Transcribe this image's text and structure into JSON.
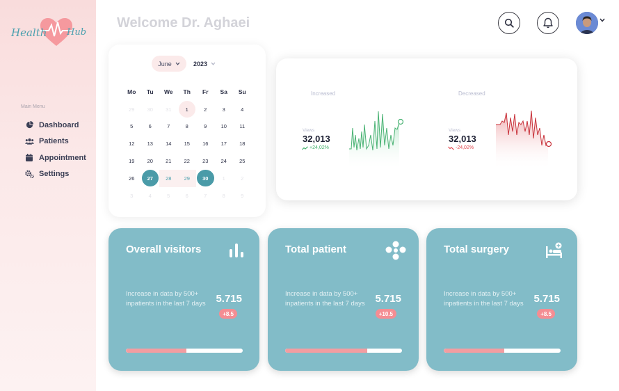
{
  "brand": {
    "part1": "Health",
    "part2": "Hub"
  },
  "header": {
    "welcome": "Welcome Dr. Aghaei"
  },
  "sidebar": {
    "menu_title": "Main Menu",
    "items": [
      {
        "label": "Dashboard",
        "icon": "pie-chart-icon"
      },
      {
        "label": "Patients",
        "icon": "users-icon"
      },
      {
        "label": "Appointment",
        "icon": "calendar-icon"
      },
      {
        "label": "Settings",
        "icon": "gears-icon"
      }
    ]
  },
  "calendar": {
    "month": "June",
    "year": "2023",
    "weekdays": [
      "Mo",
      "Tu",
      "We",
      "Th",
      "Fr",
      "Sa",
      "Su"
    ],
    "days": [
      {
        "t": "29",
        "s": "muted"
      },
      {
        "t": "30",
        "s": "muted"
      },
      {
        "t": "31",
        "s": "muted"
      },
      {
        "t": "1",
        "s": "today"
      },
      {
        "t": "2",
        "s": ""
      },
      {
        "t": "3",
        "s": ""
      },
      {
        "t": "4",
        "s": ""
      },
      {
        "t": "5",
        "s": ""
      },
      {
        "t": "6",
        "s": ""
      },
      {
        "t": "7",
        "s": ""
      },
      {
        "t": "8",
        "s": ""
      },
      {
        "t": "9",
        "s": ""
      },
      {
        "t": "10",
        "s": ""
      },
      {
        "t": "11",
        "s": ""
      },
      {
        "t": "12",
        "s": ""
      },
      {
        "t": "13",
        "s": ""
      },
      {
        "t": "14",
        "s": ""
      },
      {
        "t": "15",
        "s": ""
      },
      {
        "t": "16",
        "s": ""
      },
      {
        "t": "17",
        "s": ""
      },
      {
        "t": "18",
        "s": ""
      },
      {
        "t": "19",
        "s": ""
      },
      {
        "t": "20",
        "s": ""
      },
      {
        "t": "21",
        "s": ""
      },
      {
        "t": "22",
        "s": ""
      },
      {
        "t": "23",
        "s": ""
      },
      {
        "t": "24",
        "s": ""
      },
      {
        "t": "25",
        "s": ""
      },
      {
        "t": "26",
        "s": ""
      },
      {
        "t": "27",
        "s": "sel"
      },
      {
        "t": "28",
        "s": "hl range"
      },
      {
        "t": "29",
        "s": "hl range"
      },
      {
        "t": "30",
        "s": "sel"
      },
      {
        "t": "1",
        "s": "muted"
      },
      {
        "t": "2",
        "s": "muted"
      },
      {
        "t": "3",
        "s": "muted"
      },
      {
        "t": "4",
        "s": "muted"
      },
      {
        "t": "5",
        "s": "muted"
      },
      {
        "t": "6",
        "s": "muted"
      },
      {
        "t": "7",
        "s": "muted"
      },
      {
        "t": "8",
        "s": "muted"
      },
      {
        "t": "9",
        "s": "muted"
      }
    ]
  },
  "stats": {
    "increased": {
      "label": "Increased",
      "views_label": "Views",
      "value": "32,013",
      "delta": "+24,02%",
      "color": "#3fae6a"
    },
    "decreased": {
      "label": "Decreased",
      "views_label": "Views",
      "value": "32,013",
      "delta": "-24,02%",
      "color": "#e2444a"
    }
  },
  "cards": [
    {
      "title": "Overall visitors",
      "icon": "bar-chart-icon",
      "desc": "Increase in data by 500+ inpatients in the last 7 days",
      "value": "5.715",
      "badge": "+8.5",
      "progress": 0.52
    },
    {
      "title": "Total patient",
      "icon": "patients-group-icon",
      "desc": "Increase in data by 500+ inpatients in the last 7 days",
      "value": "5.715",
      "badge": "+10.5",
      "progress": 0.7
    },
    {
      "title": "Total surgery",
      "icon": "hospital-bed-icon",
      "desc": "Increase in data by 500+ inpatients in the last 7 days",
      "value": "5.715",
      "badge": "+8.5",
      "progress": 0.52
    }
  ],
  "colors": {
    "accent": "#82bcc8",
    "brand_pink": "#f48d93",
    "selected_day": "#4a9ba8"
  }
}
